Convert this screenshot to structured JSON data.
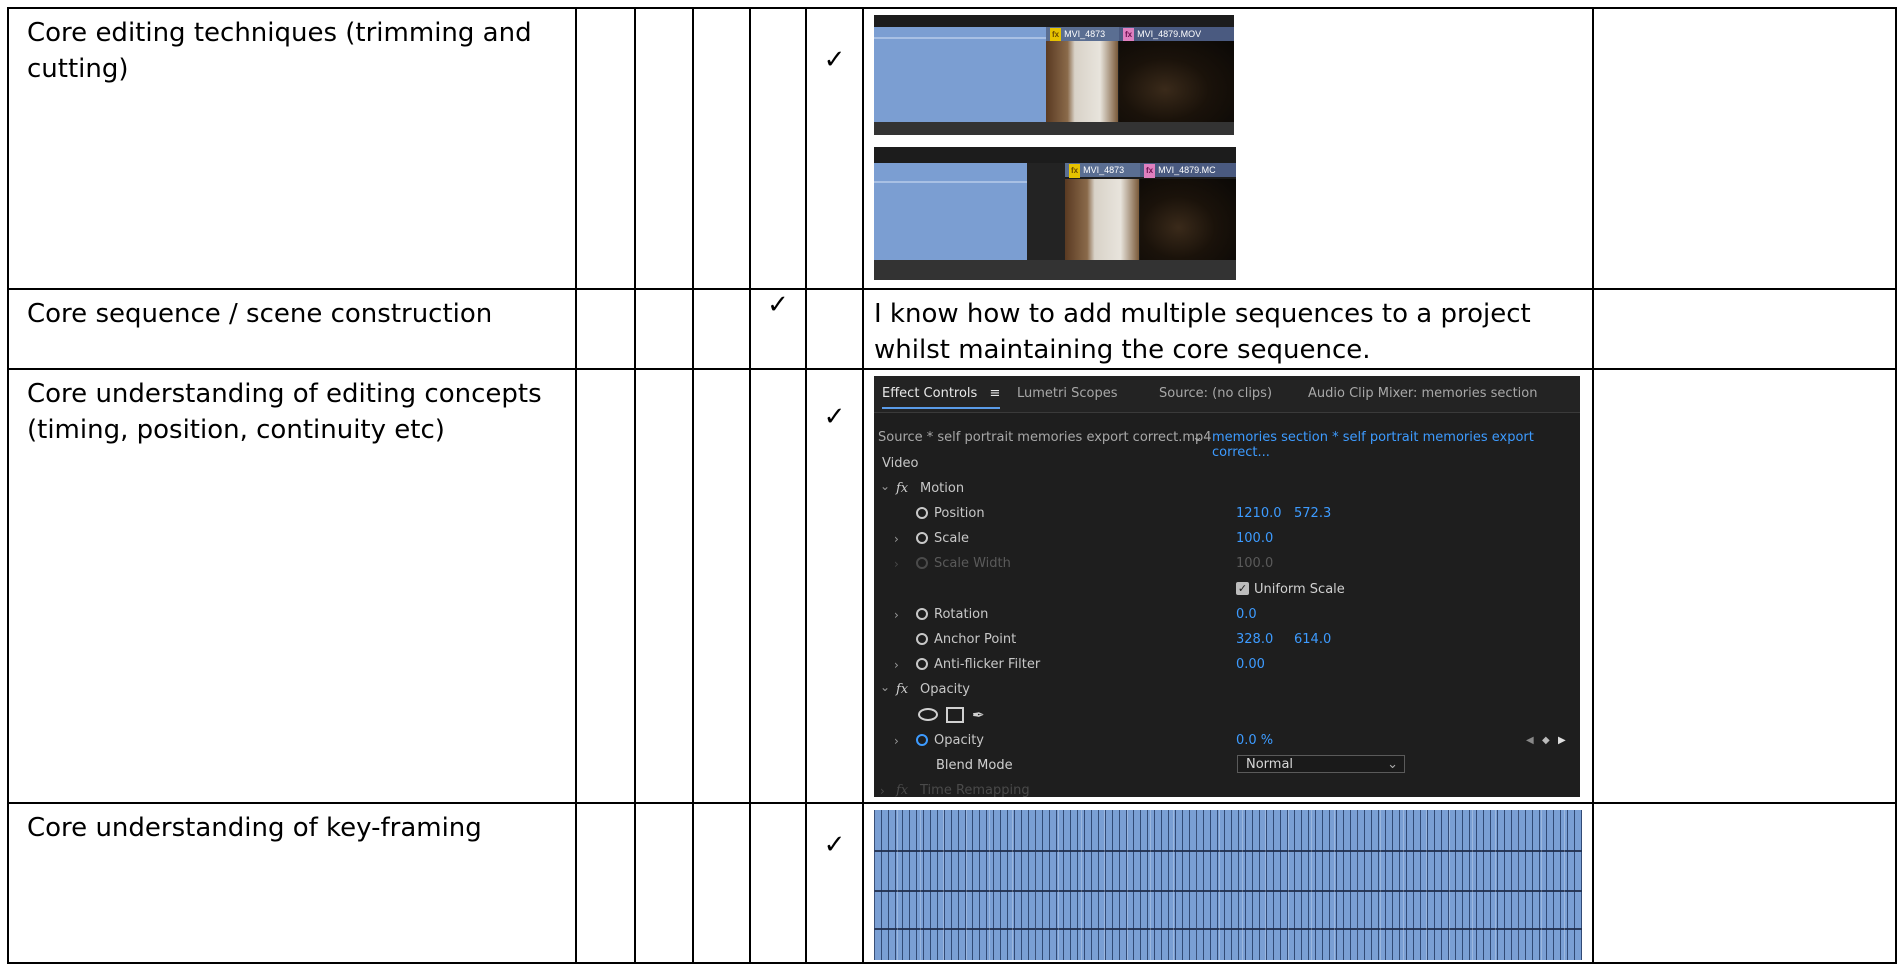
{
  "rows": [
    {
      "skill": "Core editing techniques (trimming and cutting)",
      "check_col": 5,
      "check": "✓",
      "timeline": {
        "clip1": "MVI_4873",
        "clip2": "MVI_4879.MOV",
        "clip2_cropped": "MVI_4879.MC"
      }
    },
    {
      "skill": "Core sequence / scene construction",
      "check_col": 4,
      "check": "✓",
      "evidence": "I know how to add multiple sequences to a project whilst maintaining the core sequence."
    },
    {
      "skill": "Core understanding of editing concepts (timing, position, continuity etc)",
      "check_col": 5,
      "check": "✓"
    },
    {
      "skill": "Core understanding of key-framing",
      "check_col": 5,
      "check": "✓"
    }
  ],
  "effect_controls": {
    "tabs": [
      "Effect Controls",
      "Lumetri Scopes",
      "Source: (no clips)",
      "Audio Clip Mixer: memories section"
    ],
    "source": "Source * self portrait memories export correct.mp4",
    "sequence": "memories section * self portrait memories export correct...",
    "section_video": "Video",
    "fx_symbol": "fx",
    "motion": "Motion",
    "position_label": "Position",
    "position_x": "1210.0",
    "position_y": "572.3",
    "scale_label": "Scale",
    "scale_value": "100.0",
    "scale_width_label": "Scale Width",
    "scale_width_value": "100.0",
    "uniform_scale": "Uniform Scale",
    "rotation_label": "Rotation",
    "rotation_value": "0.0",
    "anchor_label": "Anchor Point",
    "anchor_x": "328.0",
    "anchor_y": "614.0",
    "antiflicker_label": "Anti-flicker Filter",
    "antiflicker_value": "0.00",
    "opacity_section": "Opacity",
    "opacity_label": "Opacity",
    "opacity_value": "0.0 %",
    "blend_label": "Blend Mode",
    "blend_value": "Normal",
    "time_remap": "Time Remapping"
  },
  "colors": {
    "accent_blue": "#3d9bff",
    "timeline_blue": "#7b9ed2",
    "panel_bg": "#1e1e1e"
  }
}
